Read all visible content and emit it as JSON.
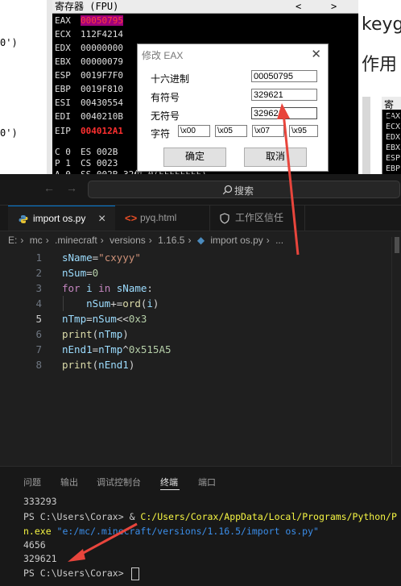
{
  "debugger": {
    "left_fragments": [
      "0')",
      "0')"
    ],
    "title": "寄存器 (FPU)",
    "title_arrows": [
      "<",
      ">"
    ],
    "registers": [
      {
        "name": "EAX",
        "value": "00050795"
      },
      {
        "name": "ECX",
        "value": "112F4214"
      },
      {
        "name": "EDX",
        "value": "00000000"
      },
      {
        "name": "EBX",
        "value": "00000079"
      },
      {
        "name": "ESP",
        "value": "0019F7F0"
      },
      {
        "name": "EBP",
        "value": "0019F810"
      },
      {
        "name": "ESI",
        "value": "00430554"
      },
      {
        "name": "EDI",
        "value": "0040210B"
      }
    ],
    "eip": {
      "name": "EIP",
      "value": "004012A1"
    },
    "flags": [
      {
        "name": "C 0",
        "seg": "ES 002B"
      },
      {
        "name": "P 1",
        "seg": "CS 0023"
      },
      {
        "name": "A 0",
        "seg": "SS 002B 32位 0(FFFFFFFF)"
      }
    ],
    "right_text": [
      "keyg",
      "作用"
    ],
    "mini_title": "寄存",
    "mini_regs": [
      "EAX",
      "ECX",
      "EDX",
      "EBX",
      "ESP",
      "EBP"
    ]
  },
  "dialog": {
    "title": "修改 EAX",
    "close": "✕",
    "hex_label": "十六进制",
    "hex_value": "00050795",
    "signed_label": "有符号",
    "signed_value": "329621",
    "unsigned_label": "无符号",
    "unsigned_value": "329621",
    "char_label": "字符",
    "chars": [
      "\\x00",
      "\\x05",
      "\\x07",
      "\\x95"
    ],
    "ok": "确定",
    "cancel": "取消"
  },
  "vscode": {
    "nav_back": "←",
    "nav_forward": "→",
    "search_label": "搜索",
    "tabs": [
      {
        "label": "import os.py",
        "active": true
      },
      {
        "label": "pyq.html",
        "active": false
      },
      {
        "label": "工作区信任",
        "active": false
      }
    ],
    "tab_close": "×",
    "breadcrumb": [
      "E:",
      "mc",
      ".minecraft",
      "versions",
      "1.16.5",
      "import os.py",
      "..."
    ],
    "current_line": 5,
    "panel_tabs": [
      "问题",
      "输出",
      "调试控制台",
      "终端",
      "端口"
    ],
    "active_panel_tab": "终端",
    "terminal": {
      "line1": "333293",
      "line2_prompt": "PS C:\\Users\\Corax> ",
      "line2_amp": "& ",
      "line2_path": "C:/Users/Corax/AppData/Local/Programs/Python/P",
      "line3_cont": "n.exe ",
      "line3_arg": "\"e:/mc/.minecraft/versions/1.16.5/import os.py\"",
      "line4": "4656",
      "line5": "329621",
      "line6_prompt": "PS C:\\Users\\Corax> "
    }
  },
  "colors": {
    "arrow": "#e8453c",
    "accent": "#0078d4"
  }
}
